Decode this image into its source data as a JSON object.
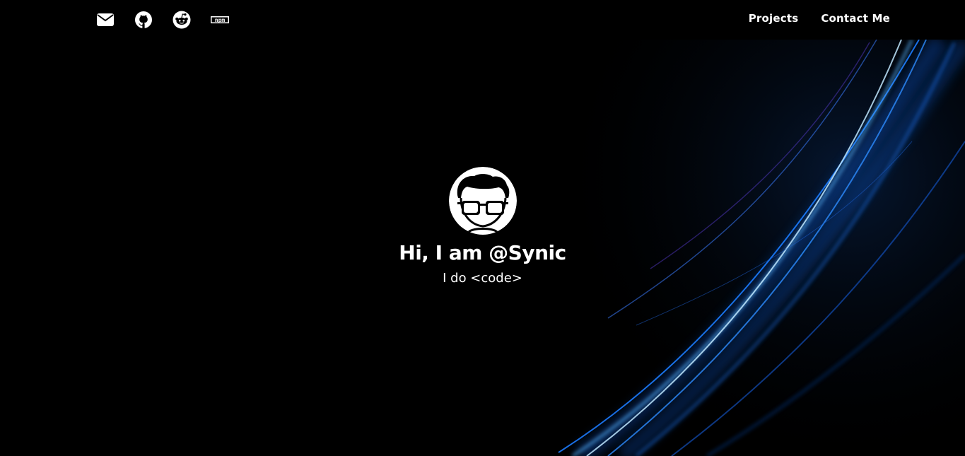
{
  "header": {
    "social_icons": [
      "envelope-icon",
      "github-icon",
      "reddit-icon",
      "npm-icon"
    ],
    "npm_text": "npm",
    "nav": [
      {
        "label": "Projects"
      },
      {
        "label": "Contact Me"
      }
    ]
  },
  "hero": {
    "avatar_icon": "glasses-avatar-icon",
    "title": "Hi, I am @Synic",
    "subtitle": "I do <code>"
  },
  "colors": {
    "background": "#000000",
    "text": "#ffffff",
    "accent_light_streak": "#1e90ff"
  }
}
